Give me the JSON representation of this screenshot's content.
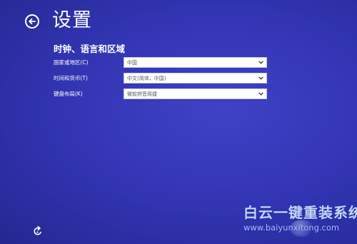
{
  "header": {
    "title": "设置"
  },
  "section": {
    "title": "时钟、语言和区域"
  },
  "settings": [
    {
      "label": "国家或地区(C)",
      "value": "中国"
    },
    {
      "label": "时间和货币(T)",
      "value": "中文(简体，中国)"
    },
    {
      "label": "键盘布局(K)",
      "value": "微软拼音简捷"
    }
  ],
  "watermark": {
    "title": "白云一键重装系统",
    "url": "www.baiyunxitong.com"
  },
  "icons": {
    "back": "back-arrow-circle-icon",
    "chevron": "chevron-down-icon",
    "sync": "sync-icon"
  },
  "colors": {
    "background": "#3436b6",
    "text": "#ffffff",
    "select_background": "#ffffff",
    "select_text": "#555566"
  }
}
